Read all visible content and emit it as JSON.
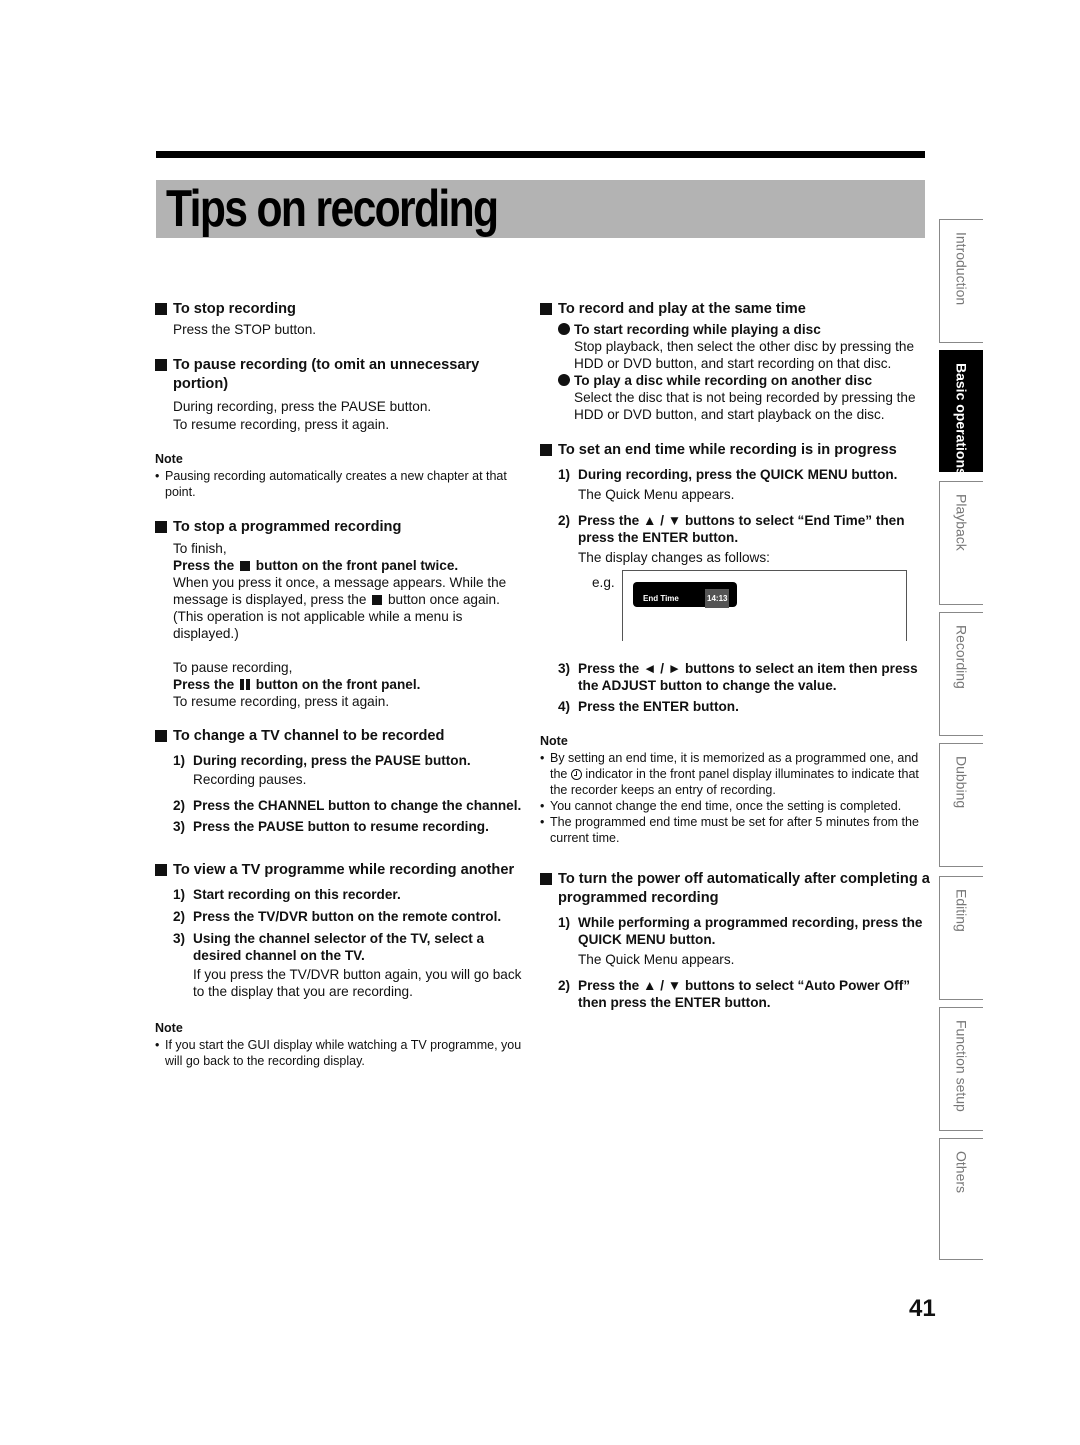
{
  "page": {
    "title": "Tips on recording",
    "page_number": "41"
  },
  "side_tabs": [
    {
      "label": "Introduction",
      "active": false
    },
    {
      "label": "Basic operations",
      "active": true
    },
    {
      "label": "Playback",
      "active": false
    },
    {
      "label": "Recording",
      "active": false
    },
    {
      "label": "Dubbing",
      "active": false
    },
    {
      "label": "Editing",
      "active": false
    },
    {
      "label": "Function setup",
      "active": false
    },
    {
      "label": "Others",
      "active": false
    }
  ],
  "left": {
    "stop": {
      "heading": "To stop recording",
      "text": "Press the STOP button."
    },
    "pause": {
      "heading": "To pause recording (to omit an unnecessary portion)",
      "line1": "During recording, press the PAUSE button.",
      "line2": "To resume recording, press it again.",
      "note_label": "Note",
      "note": "Pausing recording automatically creates a new chapter at that point."
    },
    "stop_programmed": {
      "heading": "To stop a programmed recording",
      "finish": "To finish,",
      "instr1_a": "Press the",
      "instr1_b": "button on the front panel twice.",
      "text1_a": "When you press it once, a message appears. While the message is displayed, press the",
      "text1_b": "button once again.",
      "text2": "(This operation is not applicable while a menu is displayed.)",
      "pause_intro": "To pause recording,",
      "instr2_a": "Press the",
      "instr2_b": "button on the front panel.",
      "resume": "To resume recording, press it again."
    },
    "change_channel": {
      "heading": "To change a TV channel to be recorded",
      "steps": [
        {
          "num": "1)",
          "text": "During recording, press the PAUSE button.",
          "sub": "Recording pauses."
        },
        {
          "num": "2)",
          "text": "Press the CHANNEL button to change the channel."
        },
        {
          "num": "3)",
          "text": "Press the PAUSE button to resume recording."
        }
      ]
    },
    "view_tv": {
      "heading": "To view a TV programme while recording another",
      "steps": [
        {
          "num": "1)",
          "text": "Start recording on this recorder."
        },
        {
          "num": "2)",
          "text": "Press the TV/DVR button on the remote control."
        },
        {
          "num": "3)",
          "text": "Using the channel selector of the TV, select a desired channel on the TV.",
          "sub": "If you press the TV/DVR button again, you will go back to the display that you are recording."
        }
      ],
      "note_label": "Note",
      "note": "If you start the GUI display while watching a TV programme, you will go back to the recording display."
    }
  },
  "right": {
    "record_play": {
      "heading": "To record and play at the same time",
      "items": [
        {
          "title": "To start recording while playing a disc",
          "text": "Stop playback, then select the other disc by pressing the HDD or DVD button, and start recording on that disc."
        },
        {
          "title": "To play a disc while recording on another disc",
          "text": "Select the disc that is not being recorded by pressing the HDD or DVD button, and start playback on the disc."
        }
      ]
    },
    "end_time": {
      "heading": "To set an end time while recording is in progress",
      "step1": {
        "num": "1)",
        "text": "During recording, press the QUICK MENU button.",
        "sub": "The Quick Menu appears."
      },
      "step2": {
        "num": "2)",
        "text": "Press the ▲ / ▼ buttons to select “End Time” then press the ENTER button.",
        "sub": "The display changes as follows:"
      },
      "example": {
        "label": "e.g.",
        "osd_label": "End Time",
        "osd_value": "14:13"
      },
      "step3": {
        "num": "3)",
        "text": "Press the ◄ / ► buttons to select an item then press the ADJUST button to change the value."
      },
      "step4": {
        "num": "4)",
        "text": "Press the ENTER button."
      },
      "note_label": "Note",
      "note1_a": "By setting an end time, it is memorized as a programmed one, and the",
      "note1_b": "indicator in the front panel display illuminates to indicate that the recorder keeps an entry of recording.",
      "note2": "You cannot change the end time, once the setting is completed.",
      "note3": "The programmed end time must be set for after 5 minutes from the current time."
    },
    "auto_power": {
      "heading": "To turn the power off automatically after completing a programmed recording",
      "step1": {
        "num": "1)",
        "text": "While performing a programmed recording, press the QUICK MENU button.",
        "sub": "The Quick Menu appears."
      },
      "step2": {
        "num": "2)",
        "text": "Press the ▲ / ▼ buttons to select “Auto Power Off” then press the ENTER button."
      }
    }
  }
}
